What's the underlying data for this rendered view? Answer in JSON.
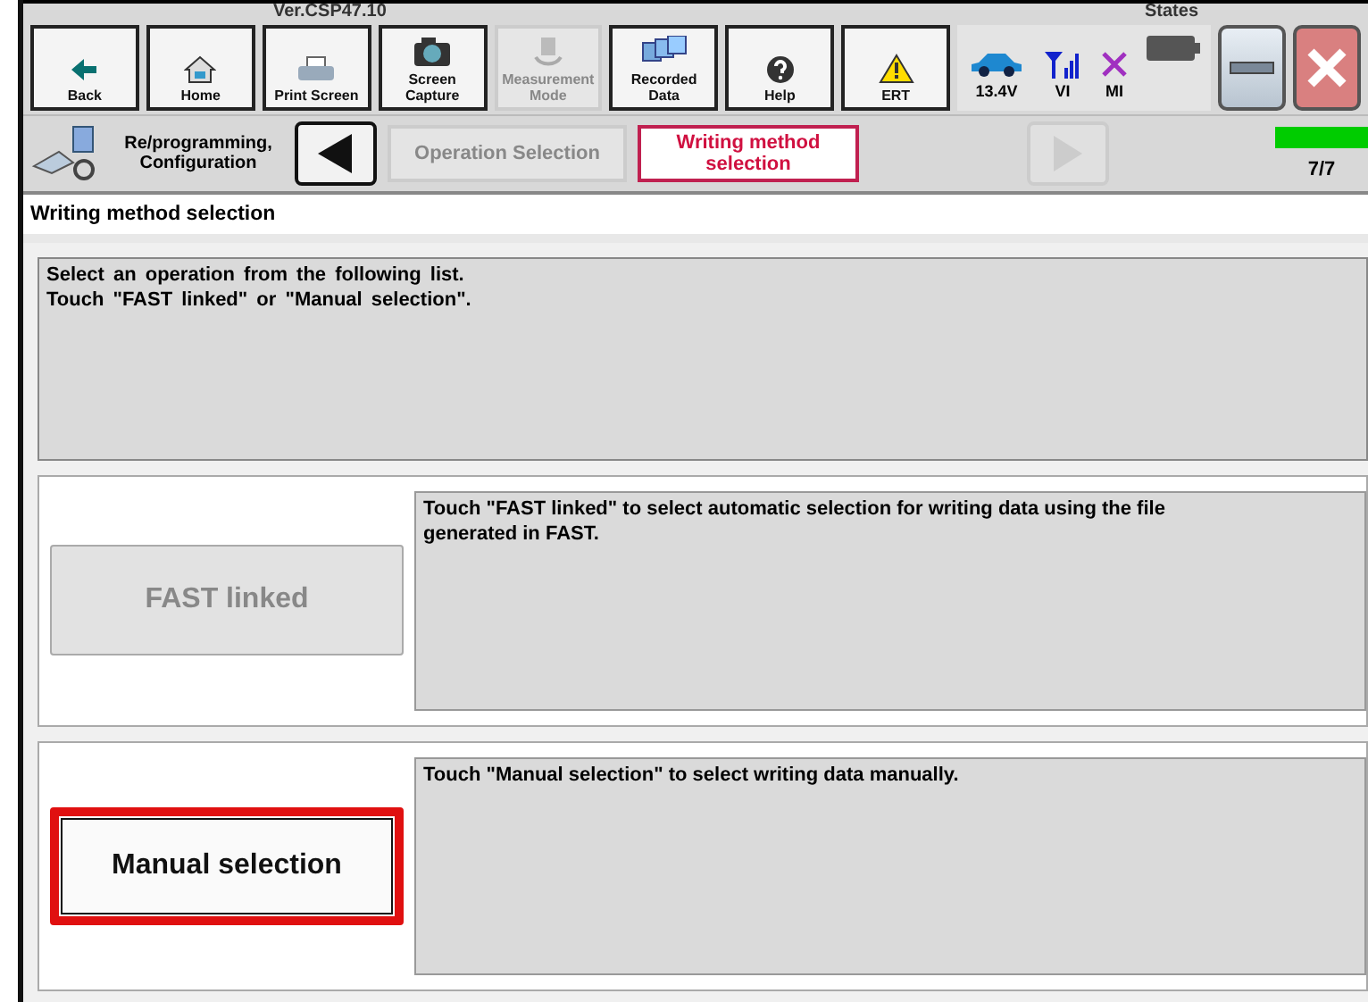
{
  "header": {
    "version": "Ver.CSP47.10",
    "states_label": "States"
  },
  "toolbar": [
    {
      "label": "Back",
      "disabled": false
    },
    {
      "label": "Home",
      "disabled": false
    },
    {
      "label": "Print Screen",
      "disabled": false
    },
    {
      "label": "Screen Capture",
      "disabled": false
    },
    {
      "label": "Measurement Mode",
      "disabled": true
    },
    {
      "label": "Recorded Data",
      "disabled": false
    },
    {
      "label": "Help",
      "disabled": false
    },
    {
      "label": "ERT",
      "disabled": false
    }
  ],
  "status": [
    {
      "label": "13.4V"
    },
    {
      "label": "VI"
    },
    {
      "label": "MI"
    }
  ],
  "breadcrumb": {
    "app": "Re/programming, Configuration",
    "steps": [
      {
        "label": "Operation Selection",
        "selected": false
      },
      {
        "label": "Writing method selection",
        "selected": true
      }
    ],
    "next_disabled": true,
    "progress": {
      "level": 1,
      "label": "7/7"
    }
  },
  "page_title": "Writing method selection",
  "instructions": [
    "Select an operation from the following list.",
    "Touch \"FAST linked\" or \"Manual selection\"."
  ],
  "options": [
    {
      "label": "FAST linked",
      "description": "Touch \"FAST linked\" to select automatic selection for writing data using the file generated in FAST.",
      "disabled": true,
      "highlighted": false
    },
    {
      "label": "Manual selection",
      "description": "Touch \"Manual selection\" to select writing data manually.",
      "disabled": false,
      "highlighted": true
    }
  ]
}
